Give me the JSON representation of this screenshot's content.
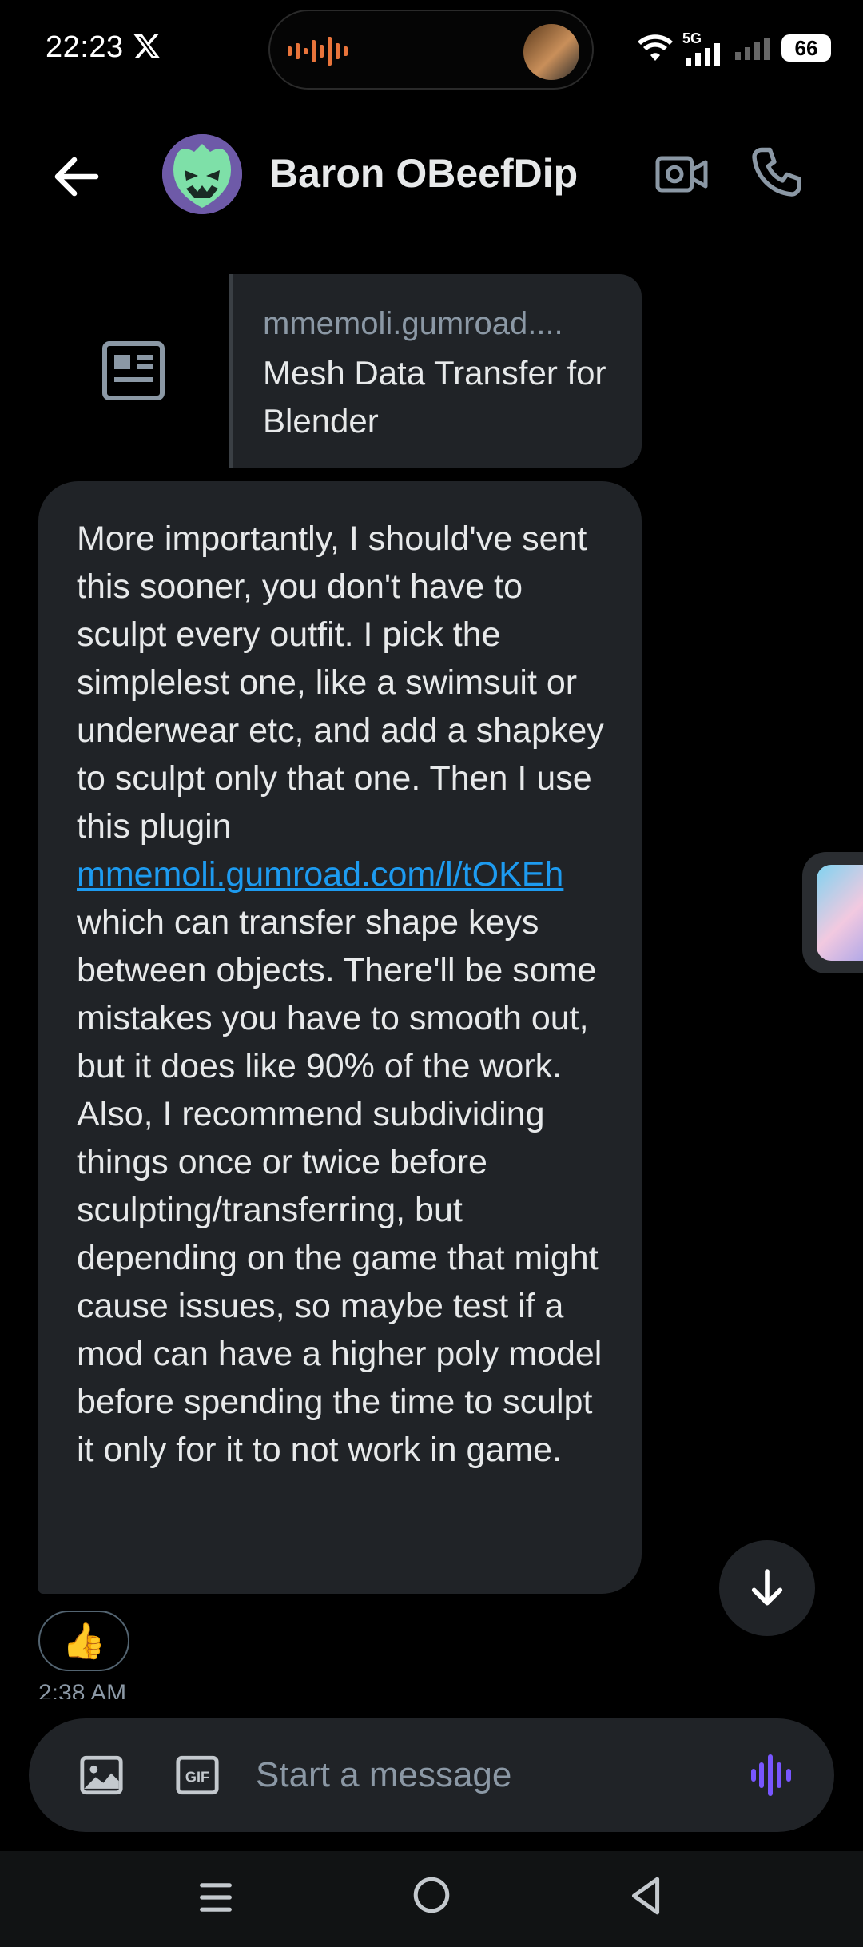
{
  "status_bar": {
    "time": "22:23",
    "network": "5G",
    "battery": "66"
  },
  "header": {
    "contact_name": "Baron OBeefDip"
  },
  "link_card": {
    "domain": "mmemoli.gumroad....",
    "title": "Mesh Data Transfer for Blender"
  },
  "message": {
    "text_before_link": "More importantly, I should've sent this sooner, you don't have to sculpt every outfit. I pick the simplelest one, like a swimsuit or underwear etc, and add a shapkey to sculpt only that one. Then I use this plugin ",
    "link_text": "mmemoli.gumroad.com/l/tOKEh",
    "text_after_link": " which can transfer shape keys between objects. There'll be some mistakes you have to smooth out, but it does like 90% of the work. Also, I recommend subdividing things once or twice before sculpting/transferring, but depending on the game that might cause issues, so maybe test if a mod can have a higher poly model before spending the time to sculpt it only for it to not work in game.",
    "reaction": "👍",
    "timestamp": "2:38 AM"
  },
  "composer": {
    "placeholder": "Start a message"
  },
  "icons": {
    "back": "back-arrow-icon",
    "video": "video-camera-icon",
    "call": "phone-icon",
    "image": "image-icon",
    "gif": "gif-icon",
    "voice": "voice-wave-icon",
    "scroll": "arrow-down-icon"
  },
  "colors": {
    "accent": "#1d9bf0",
    "voice": "#7856ff",
    "bubble": "#202327"
  }
}
